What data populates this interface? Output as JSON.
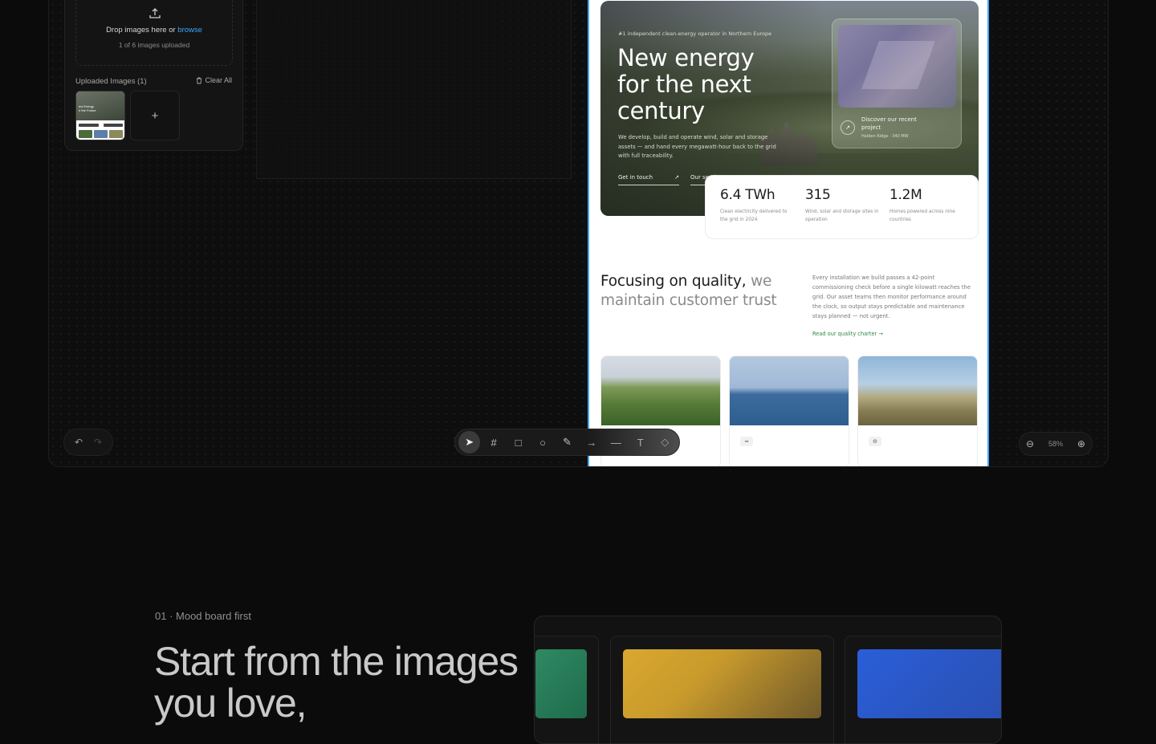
{
  "upload": {
    "drop_text": "Drop images here or ",
    "browse": "browse",
    "count": "1 of 6 images uploaded",
    "uploaded_title": "Uploaded Images (1)",
    "clear_all": "Clear All",
    "thumb_text": "ew Energy\ne the Future",
    "add": "+"
  },
  "preview": {
    "kicker": "#1 independent clean-energy operator in Northern Europe",
    "title": "New energy for the next century",
    "description": "We develop, build and operate wind, solar and storage assets — and hand every megawatt-hour back to the grid with full traceability.",
    "links": [
      {
        "label": "Get in touch",
        "arrow": "↗"
      },
      {
        "label": "Our services",
        "arrow": "↗"
      }
    ],
    "project": {
      "arrow": "↗",
      "title": "Discover our recent project",
      "subtitle": "Halden Ridge · 340 MW"
    },
    "stats": [
      {
        "value": "6.4 TWh",
        "label": "Clean electricity delivered to the grid in 2024"
      },
      {
        "value": "315",
        "label": "Wind, solar and storage sites in operation"
      },
      {
        "value": "1.2M",
        "label": "Homes powered across nine countries"
      }
    ],
    "quality": {
      "title_strong": "Focusing on quality,",
      "title_muted": " we maintain customer trust",
      "description": "Every installation we build passes a 42-point commissioning check before a single kilowatt reaches the grid. Our asset teams then monitor performance around the clock, so output stays predictable and maintenance stays planned — not urgent.",
      "link": "Read our quality charter →"
    },
    "cards": [
      {
        "icon": "☼"
      },
      {
        "icon": "≈"
      },
      {
        "icon": "⊖"
      }
    ]
  },
  "toolbar": {
    "undo": "↶",
    "redo": "↷",
    "tools": [
      {
        "icon": "cursor-icon",
        "glyph": "➤"
      },
      {
        "icon": "frame-icon",
        "glyph": "#"
      },
      {
        "icon": "rectangle-icon",
        "glyph": "□"
      },
      {
        "icon": "ellipse-icon",
        "glyph": "○"
      },
      {
        "icon": "pencil-icon",
        "glyph": "✎"
      },
      {
        "icon": "arrow-icon",
        "glyph": "→"
      },
      {
        "icon": "line-icon",
        "glyph": "—"
      },
      {
        "icon": "text-icon",
        "glyph": "T"
      },
      {
        "icon": "eraser-icon",
        "glyph": "◇"
      }
    ],
    "zoom_out": "⊖",
    "zoom_value": "58%",
    "zoom_in": "⊕"
  },
  "section": {
    "label": "01 · Mood board first",
    "title": "Start from the images you love,"
  },
  "colors": {
    "accent": "#41a7ff",
    "browse_link": "#3aa7ff",
    "quality_link": "#2f8a46",
    "swatch_green": "#2e8a63",
    "swatch_gold": "#c89a2c",
    "swatch_blue": "#2a5ed8"
  }
}
